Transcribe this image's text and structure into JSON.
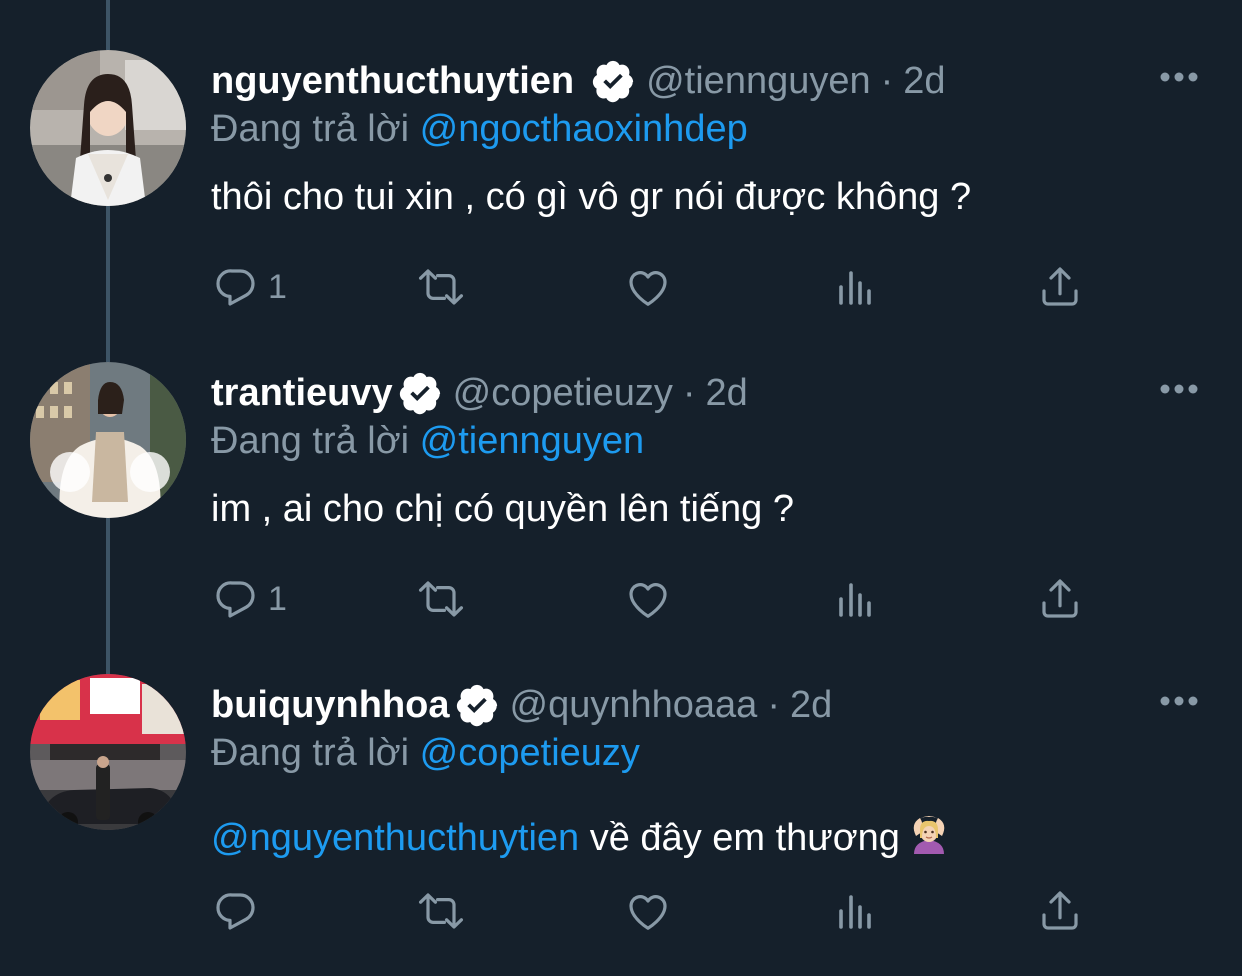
{
  "tweets": [
    {
      "display_name": "nguyenthucthuytien",
      "handle": "@tiennguyen",
      "separator": "·",
      "time": "2d",
      "reply_prefix": "Đang trả lời",
      "reply_to": "@ngocthaoxinhdep",
      "text": "thôi cho tui xin , có gì vô gr nói được không ?",
      "reply_count": "1",
      "verified": true
    },
    {
      "display_name": "trantieuvy",
      "handle": "@copetieuzy",
      "separator": "·",
      "time": "2d",
      "reply_prefix": "Đang trả lời",
      "reply_to": "@tiennguyen",
      "text": "im , ai cho chị có quyền lên tiếng ?",
      "reply_count": "1",
      "verified": true
    },
    {
      "display_name": "buiquynhhoa",
      "handle": "@quynhhoaaa",
      "separator": "·",
      "time": "2d",
      "reply_prefix": "Đang trả lời",
      "reply_to": "@copetieuzy",
      "text_mention": "@nguyenthucthuytien",
      "text": " về đây em thương",
      "text_emoji": "person-gesturing-ok-icon",
      "reply_count": "",
      "verified": true
    }
  ],
  "colors": {
    "background": "#15202b",
    "primary_text": "#ffffff",
    "secondary_text": "#8899a6",
    "link": "#1d9bf0",
    "thread_line": "#3d5466"
  },
  "icons": [
    "verified-badge-icon",
    "more-icon",
    "reply-icon",
    "retweet-icon",
    "like-icon",
    "analytics-icon",
    "share-icon"
  ]
}
